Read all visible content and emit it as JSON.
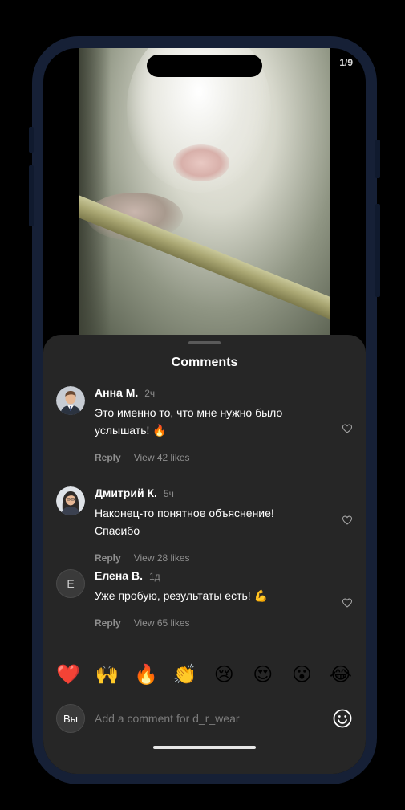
{
  "video": {
    "page_counter": "1/9"
  },
  "comments_sheet": {
    "title": "Comments",
    "comments": [
      {
        "author": "Анна М.",
        "time": "2ч",
        "text": "Это именно то, что мне нужно было услышать! 🔥",
        "reply_label": "Reply",
        "likes_label": "View 42 likes",
        "avatar": "photo"
      },
      {
        "author": "Дмитрий К.",
        "time": "5ч",
        "text": "Наконец-то понятное объяснение! Спасибо",
        "reply_label": "Reply",
        "likes_label": "View 28 likes",
        "avatar": "photo"
      },
      {
        "author": "Елена В.",
        "time": "1д",
        "text": "Уже пробую, результаты есть! 💪",
        "reply_label": "Reply",
        "likes_label": "View 65 likes",
        "avatar_letter": "E"
      }
    ],
    "emoji_bar": [
      "❤️",
      "🙌",
      "🔥",
      "👏",
      "😢",
      "😍",
      "😮",
      "😂"
    ],
    "input": {
      "avatar_text": "Вы",
      "placeholder": "Add a comment for d_r_wear"
    }
  },
  "colors": {
    "phone_frame": "#162036",
    "sheet_bg": "#262626",
    "text_primary": "#ffffff",
    "text_secondary": "#8f8f8f"
  }
}
